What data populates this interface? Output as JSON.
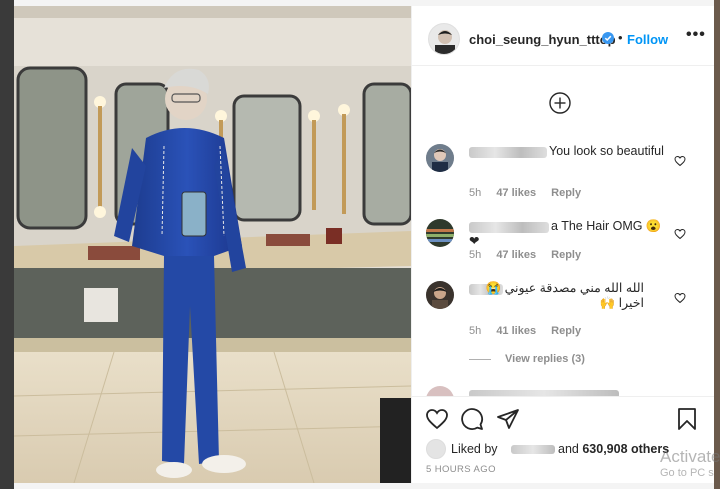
{
  "post": {
    "username": "choi_seung_hyun_tttop",
    "follow_label": "Follow",
    "separator": "•"
  },
  "comments": [
    {
      "text": "You look so beautiful",
      "time": "5h",
      "likes": "47 likes",
      "reply": "Reply"
    },
    {
      "text": "a The Hair OMG 😮❤",
      "time": "5h",
      "likes": "47 likes",
      "reply": "Reply"
    },
    {
      "text": "الله الله مني مصدقة عيوني 😭 اخيرا 🙌",
      "time": "5h",
      "likes": "41 likes",
      "reply": "Reply"
    }
  ],
  "view_replies": "View replies (3)",
  "likes_summary": {
    "prefix": "Liked by",
    "suffix": "and",
    "others": "630,908 others"
  },
  "time_ago": "5 HOURS AGO",
  "watermark": {
    "line1": "Activate",
    "line2": "Go to PC s"
  },
  "colors": {
    "link_blue": "#0095f6",
    "verified_blue": "#3897f0",
    "text": "#262626",
    "muted": "#8e8e8e"
  },
  "icons": {
    "more": "ellipsis-icon",
    "add": "plus-circle-icon",
    "like": "heart-outline-icon",
    "comment": "speech-bubble-icon",
    "share": "paper-plane-icon",
    "save": "bookmark-icon"
  }
}
